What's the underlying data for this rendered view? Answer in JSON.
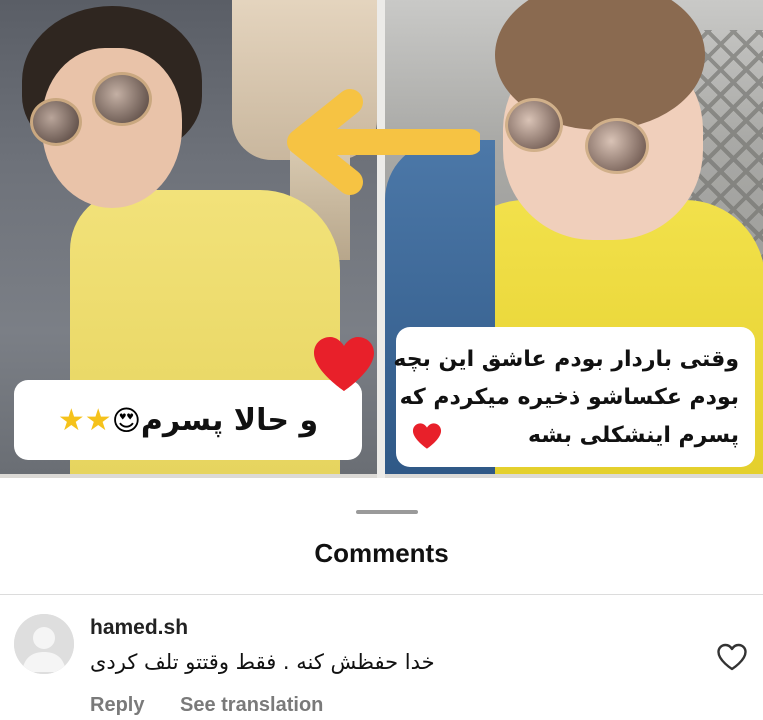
{
  "post": {
    "caption_left": "و حالا پسرم",
    "caption_right_lines": [
      "وقتی باردار بودم عاشق این بچه",
      "بودم عکساشو ذخیره میکردم که",
      "پسرم اینشکلی بشه"
    ]
  },
  "colors": {
    "arrow": "#f6c343",
    "heart": "#e8202a",
    "star": "#f5c21b",
    "muted_text": "#7a7a7a"
  },
  "comments": {
    "title": "Comments",
    "items": [
      {
        "username": "hamed.sh",
        "text": "خدا حفظش کنه . فقط وقتتو تلف کردی",
        "reply_label": "Reply",
        "translate_label": "See translation"
      }
    ]
  }
}
